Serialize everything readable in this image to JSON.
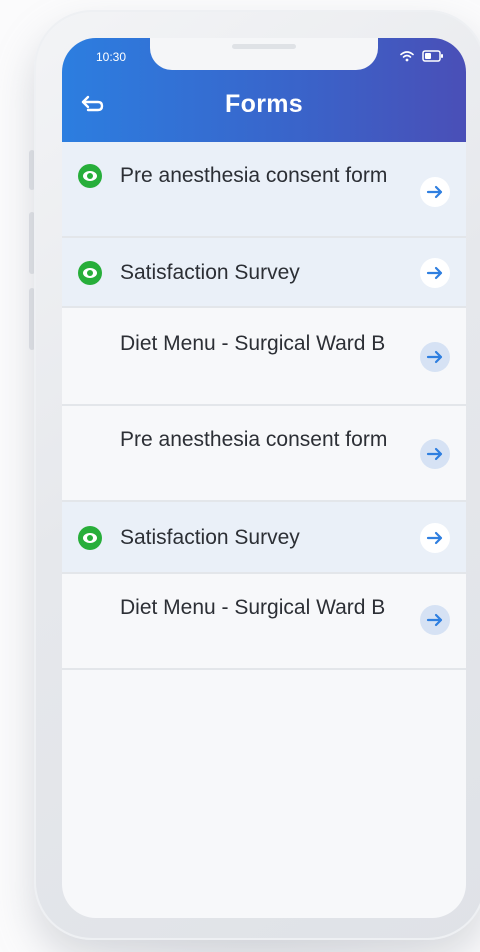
{
  "status_bar": {
    "time": "10:30",
    "icons": [
      "wifi-icon",
      "battery-icon"
    ]
  },
  "header": {
    "title": "Forms",
    "back_icon": "back-arrow-icon",
    "gradient_colors": [
      "#2c7ee0",
      "#4a4fb7"
    ]
  },
  "forms": [
    {
      "label": "Pre anesthesia consent form",
      "viewed": true
    },
    {
      "label": "Satisfaction Survey",
      "viewed": true
    },
    {
      "label": "Diet Menu - Surgical Ward B",
      "viewed": false
    },
    {
      "label": "Pre anesthesia consent form",
      "viewed": false
    },
    {
      "label": "Satisfaction Survey",
      "viewed": true
    },
    {
      "label": "Diet Menu - Surgical Ward B",
      "viewed": false
    }
  ],
  "colors": {
    "viewed_icon": "#27ae3a",
    "arrow": "#2f7fe0",
    "unread_row_bg": "#eaf0f8"
  }
}
